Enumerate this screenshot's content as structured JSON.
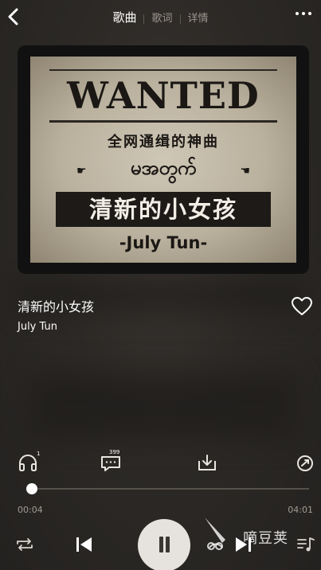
{
  "header": {
    "tabs": [
      {
        "label": "歌曲",
        "active": true
      },
      {
        "label": "歌词",
        "active": false
      },
      {
        "label": "详情",
        "active": false
      }
    ]
  },
  "cover": {
    "heading": "WANTED",
    "subheading": "全网通缉的神曲",
    "burmese": "မအတွက်",
    "title": "清新的小女孩",
    "byline": "-July Tun-"
  },
  "song": {
    "title": "清新的小女孩",
    "artist": "July Tun",
    "liked": false
  },
  "actions": {
    "listen_badge": "1",
    "comment_badge": "399"
  },
  "progress": {
    "current": "00:04",
    "total": "04:01",
    "fraction": 0.0166
  },
  "watermark": {
    "text": "嘀豆荚"
  },
  "colors": {
    "background": "#2c2926",
    "accent": "#ffffff",
    "muted": "#a29b94"
  },
  "icons": [
    "back-icon",
    "more-icon",
    "heart-icon",
    "headphones-icon",
    "comment-icon",
    "download-icon",
    "share-icon",
    "repeat-icon",
    "previous-icon",
    "pause-icon",
    "next-icon",
    "playlist-icon"
  ]
}
